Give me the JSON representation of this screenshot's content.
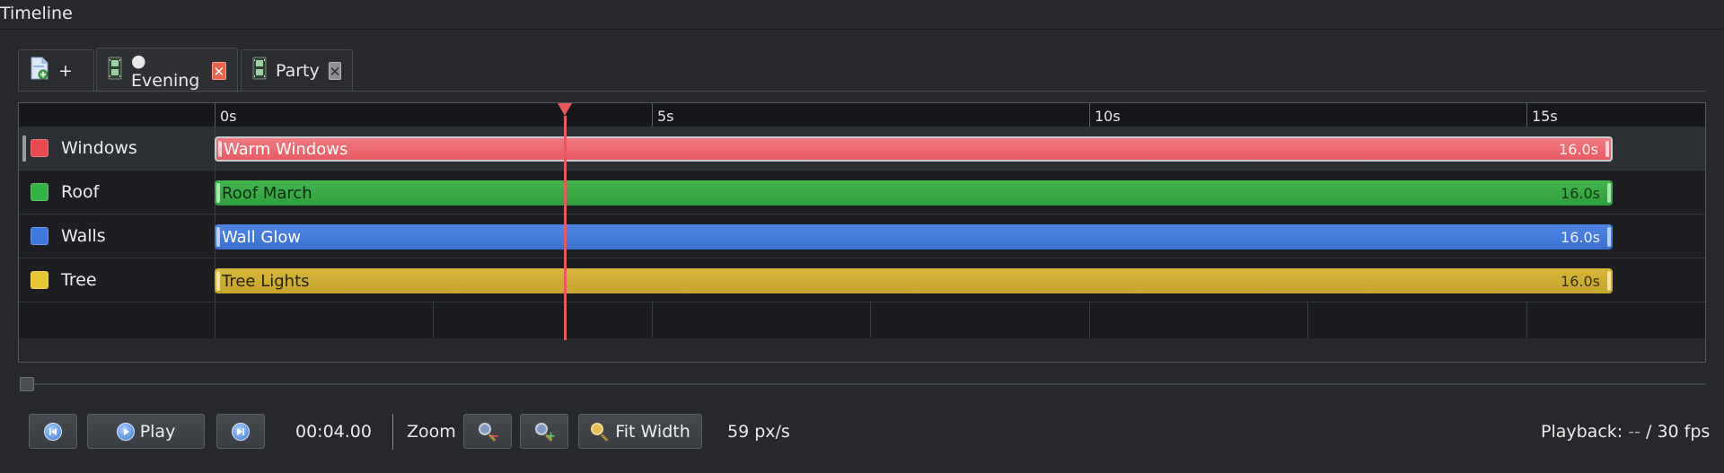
{
  "panel": {
    "title": "Timeline"
  },
  "tabs": [
    {
      "label": "+",
      "icon": "new-sequence-icon",
      "active": false
    },
    {
      "label": "● Evening",
      "icon": "film-strip-icon",
      "close": "✕",
      "active": true
    },
    {
      "label": "Party",
      "icon": "film-strip-icon",
      "close": "✕",
      "active": false
    }
  ],
  "ruler": {
    "labels": [
      "0s",
      "5s",
      "10s",
      "15s"
    ]
  },
  "tracks": [
    {
      "name": "Windows",
      "color": "#e84a4f",
      "clip": {
        "label": "Warm Windows",
        "duration": "16.0s",
        "style": "red"
      },
      "selected": true
    },
    {
      "name": "Roof",
      "color": "#33b245",
      "clip": {
        "label": "Roof March",
        "duration": "16.0s",
        "style": "green"
      },
      "selected": false
    },
    {
      "name": "Walls",
      "color": "#3e78e0",
      "clip": {
        "label": "Wall Glow",
        "duration": "16.0s",
        "style": "blue"
      },
      "selected": false
    },
    {
      "name": "Tree",
      "color": "#e5c531",
      "clip": {
        "label": "Tree Lights",
        "duration": "16.0s",
        "style": "gold"
      },
      "selected": false
    }
  ],
  "playhead": {
    "time_seconds": 4.0,
    "color": "#e8585f"
  },
  "controls": {
    "play_label": "Play",
    "time": "00:04.00",
    "zoom_label": "Zoom",
    "fit_width_label": "Fit Width",
    "scale": "59 px/s",
    "playback_label": "Playback:",
    "playback_value": "--",
    "playback_fps": "/ 30 fps"
  }
}
